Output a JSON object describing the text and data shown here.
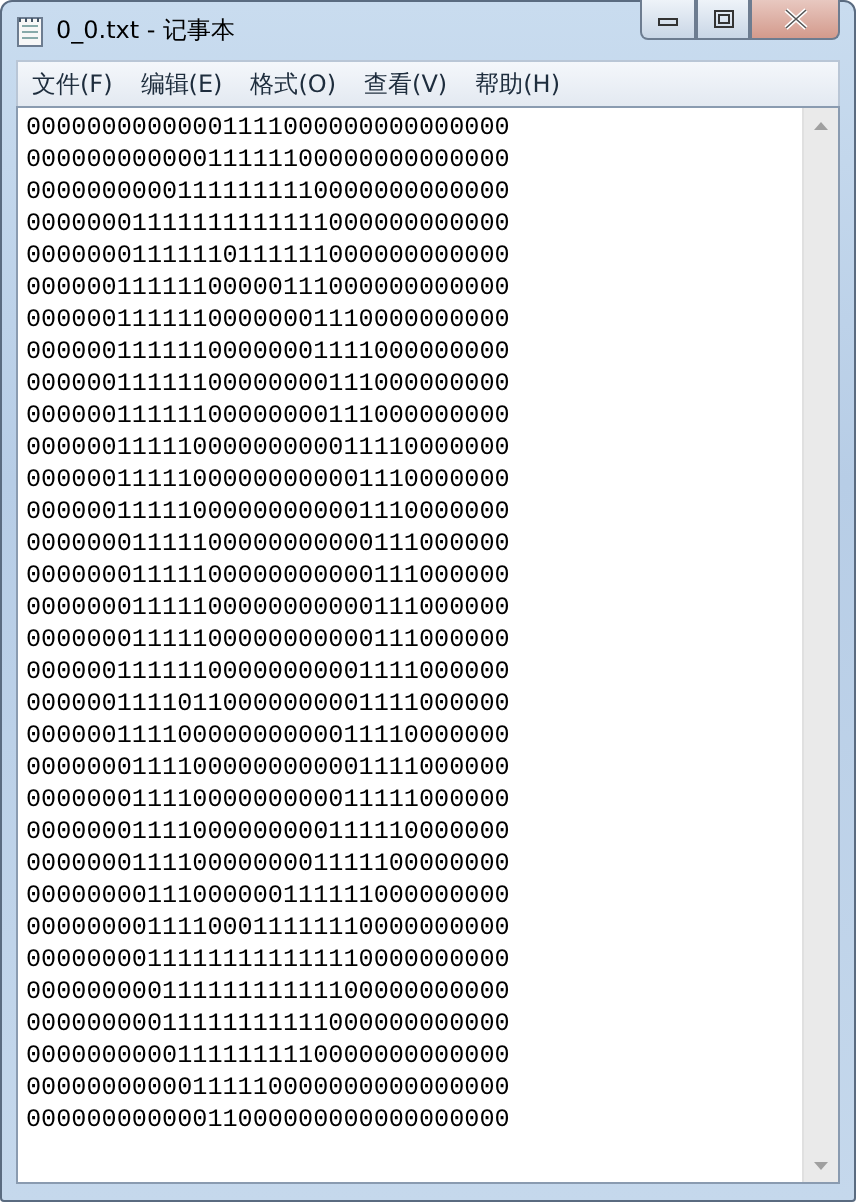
{
  "window": {
    "title": "0_0.txt - 记事本"
  },
  "menu": [
    "文件(F)",
    "编辑(E)",
    "格式(O)",
    "查看(V)",
    "帮助(H)"
  ],
  "lines": [
    "00000000000001111000000000000000",
    "00000000000011111100000000000000",
    "00000000001111111110000000000000",
    "00000001111111111111000000000000",
    "00000001111110111111000000000000",
    "00000011111100000111000000000000",
    "00000011111100000001110000000000",
    "00000011111100000001111000000000",
    "00000011111100000000111000000000",
    "00000011111100000000111000000000",
    "00000011111000000000011110000000",
    "00000011111000000000001110000000",
    "00000011111000000000001110000000",
    "00000001111100000000000111000000",
    "00000001111100000000000111000000",
    "00000001111100000000000111000000",
    "00000001111100000000000111000000",
    "00000011111100000000001111000000",
    "00000011110110000000001111000000",
    "00000011110000000000011110000000",
    "00000001111000000000001111000000",
    "00000001111000000000011111000000",
    "00000001111000000000111110000000",
    "00000001111000000001111100000000",
    "00000000111000000111111000000000",
    "00000000111100011111110000000000",
    "00000000111111111111110000000000",
    "00000000011111111111100000000000",
    "00000000011111111111000000000000",
    "00000000001111111110000000000000",
    "00000000000111110000000000000000",
    "00000000000011000000000000000000"
  ]
}
